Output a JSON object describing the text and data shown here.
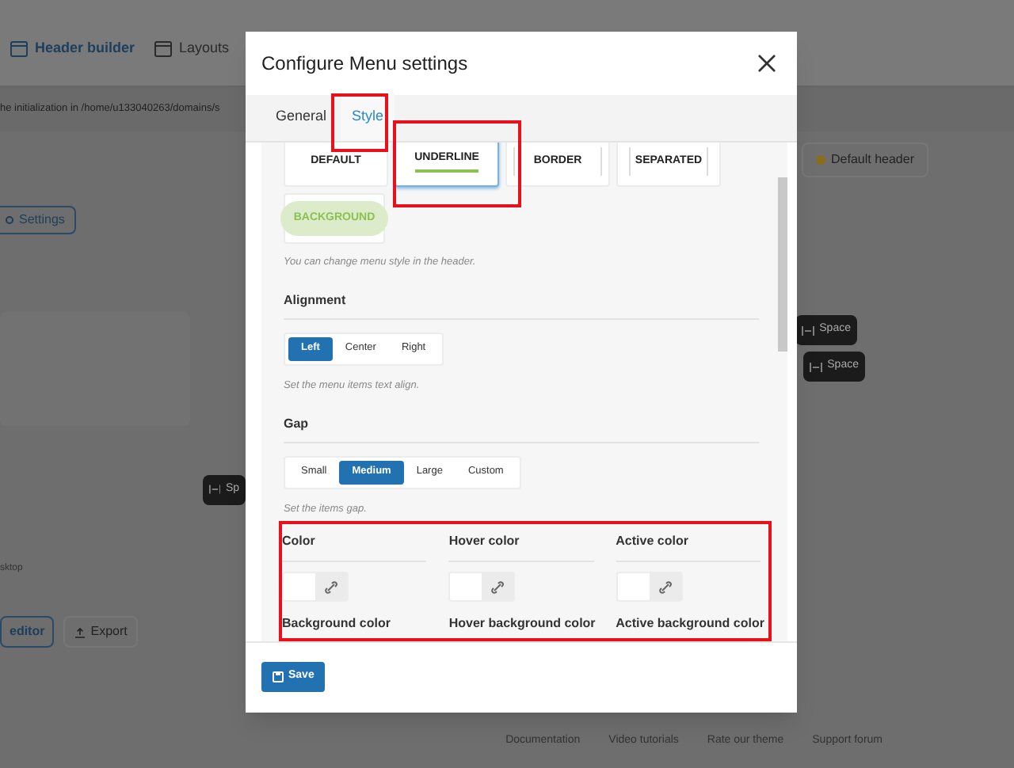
{
  "background": {
    "toolbar": [
      {
        "label": "Header builder",
        "selected": true
      },
      {
        "label": "Layouts",
        "selected": false
      }
    ],
    "notice": "he initialization in /home/u133040263/domains/s",
    "default_header": "Default header",
    "settings_button": "Settings",
    "space_buttons": [
      "Space",
      "Space",
      "Sp"
    ],
    "desktop_label": "sktop",
    "buttons": [
      {
        "label": "editor",
        "kind": "outline"
      },
      {
        "label": "Export",
        "kind": "export"
      }
    ],
    "footer_links": [
      "Documentation",
      "Video tutorials",
      "Rate our theme",
      "Support forum"
    ]
  },
  "dialog": {
    "title": "Configure Menu settings",
    "tabs": [
      {
        "label": "General",
        "selected": false
      },
      {
        "label": "Style",
        "selected": true
      }
    ],
    "menu_styles": [
      {
        "label": "DEFAULT",
        "kind": "plain",
        "selected": false
      },
      {
        "label": "UNDERLINE",
        "kind": "underline",
        "selected": true
      },
      {
        "label": "BORDER",
        "kind": "border",
        "selected": false
      },
      {
        "label": "SEPARATED",
        "kind": "separated",
        "selected": false
      },
      {
        "label": "BACKGROUND",
        "kind": "background",
        "selected": false
      }
    ],
    "menu_style_hint": "You can change menu style in the header.",
    "alignment": {
      "heading": "Alignment",
      "options": [
        {
          "label": "Left",
          "selected": true
        },
        {
          "label": "Center",
          "selected": false
        },
        {
          "label": "Right",
          "selected": false
        }
      ],
      "hint": "Set the menu items text align."
    },
    "gap": {
      "heading": "Gap",
      "options": [
        {
          "label": "Small",
          "selected": false
        },
        {
          "label": "Medium",
          "selected": true
        },
        {
          "label": "Large",
          "selected": false
        },
        {
          "label": "Custom",
          "selected": false
        }
      ],
      "hint": "Set the items gap."
    },
    "colors": [
      "Color",
      "Hover color",
      "Active color"
    ],
    "background_colors": [
      "Background color",
      "Hover background color",
      "Active background color"
    ],
    "save_button": "Save"
  }
}
